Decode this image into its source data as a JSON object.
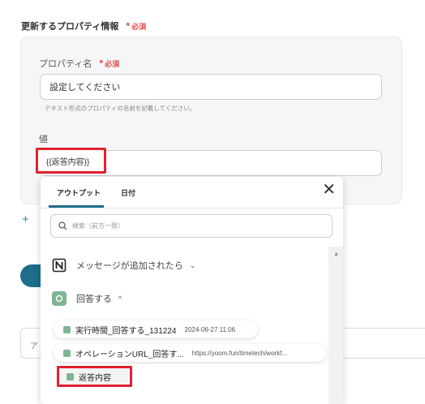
{
  "section": {
    "title": "更新するプロパティ情報",
    "required_star": "*",
    "required_label": "必須"
  },
  "property_name": {
    "label": "プロパティ名",
    "required_star": "*",
    "required_label": "必須",
    "value": "設定してください",
    "help": "テキスト形式のプロパティの名前を記載してください。"
  },
  "value_field": {
    "label": "値",
    "chip_text": "{{返答内容}}"
  },
  "background": {
    "plus": "+",
    "field_fragment": "ア"
  },
  "dropdown": {
    "tabs": [
      {
        "label": "アウトプット",
        "active": true
      },
      {
        "label": "日付",
        "active": false
      }
    ],
    "close_glyph": "✕",
    "search_placeholder": "検索（前方一致）",
    "groups": [
      {
        "label": "メッセージが追加されたら",
        "chevron": "⌄",
        "icon": "notion-icon"
      },
      {
        "label": "回答する",
        "chevron": "^",
        "icon": "openai-icon"
      }
    ],
    "items": [
      {
        "label": "実行時間_回答する_131224",
        "meta": "2024-06-27 11:06"
      },
      {
        "label": "オペレーションURL_回答す...",
        "meta": "https://yoom.fun/timetech/workf..."
      },
      {
        "label": "返答内容",
        "meta": ""
      }
    ]
  },
  "colors": {
    "accent": "#1d6e8c",
    "required": "#e5484d",
    "highlight": "#e2212f",
    "item_icon": "#7db592"
  }
}
